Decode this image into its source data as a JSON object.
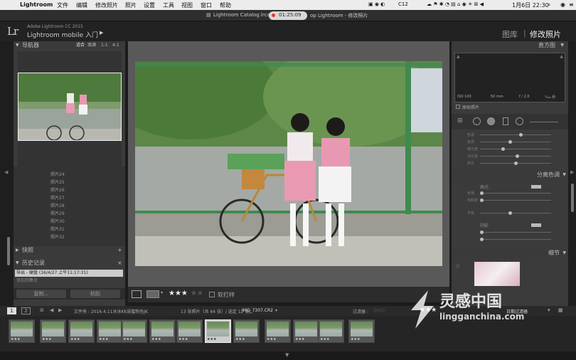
{
  "menubar": {
    "app": "Lightroom",
    "items": [
      "文件",
      "编辑",
      "修改照片",
      "照片",
      "设置",
      "工具",
      "视图",
      "窗口",
      "帮助"
    ],
    "status": "C12",
    "date": "1月6日  22:30"
  },
  "titlebar": {
    "left": "Lightroom Catalog.lrca",
    "timer": "01:25:09",
    "right": "op Lightroom - 修改照片"
  },
  "header": {
    "logo": "Lr",
    "product": "Adobe Lightroom CC 2015",
    "title": "Lightroom mobile 入门",
    "module_library": "图库",
    "module_separator": "|",
    "module_develop": "修改照片"
  },
  "left_panel": {
    "navigator_title": "导航器",
    "zoom_options": [
      "适合",
      "填满",
      "1:1",
      "4:1"
    ],
    "folders": [
      "照片24",
      "照片25",
      "照片26",
      "照片27",
      "照片28",
      "照片29",
      "照片30",
      "照片31",
      "照片32"
    ],
    "snapshots_title": "快照",
    "history_title": "历史记录",
    "history_items": [
      "导出 - 硬盘 (16/4/27 上午11:17:31)",
      "添加到集合"
    ],
    "copy_button": "复制...",
    "paste_button": "粘贴"
  },
  "toolbar": {
    "rating": "★★★",
    "rating_empty": "★★",
    "soft_proof": "软打样"
  },
  "right_panel": {
    "histogram_title": "直方图",
    "iso": "ISO 100",
    "focal": "50 mm",
    "aperture": "f / 2.0",
    "shutter": "¹⁄₄₀₀ 秒",
    "original_photo": "原始照片",
    "split_tone_title": "分离色调",
    "highlights_label": "高光",
    "shadows_label": "阴影",
    "hue_label": "色相",
    "sat_label": "饱和度",
    "balance_label": "平衡",
    "detail_title": "细节",
    "basic_sliders": [
      "色温",
      "色调",
      "曝光度",
      "对比度",
      "高光"
    ]
  },
  "filmstrip_bar": {
    "page1": "1",
    "page2": "2",
    "source": "文件夹 : 2016.4.11冰冰KK闺蜜粉色JK",
    "count": "13 张照片（共 64 张）/ 选定 12 张/",
    "filename": "IMG_7307.CR2",
    "filter_label": "过滤器 :",
    "filter_stars": "★★★",
    "filter_value": "日期过滤器"
  },
  "filmstrip": {
    "thumb_count": 13,
    "ratings": [
      "★★★",
      "★★★",
      "★★★",
      "★★★",
      "★★★",
      "★★★",
      "★★★",
      "★★★",
      "★★★",
      "★★★",
      "★★★",
      "★★★",
      "★★★"
    ]
  },
  "watermark": {
    "cn": "灵感中国",
    "en": "lingganchina.com"
  },
  "colors": {
    "background": "#1c1c1c",
    "panel": "#3b3b3b",
    "header_bar": "#3a3a3a",
    "accent_text": "#dddddd"
  }
}
